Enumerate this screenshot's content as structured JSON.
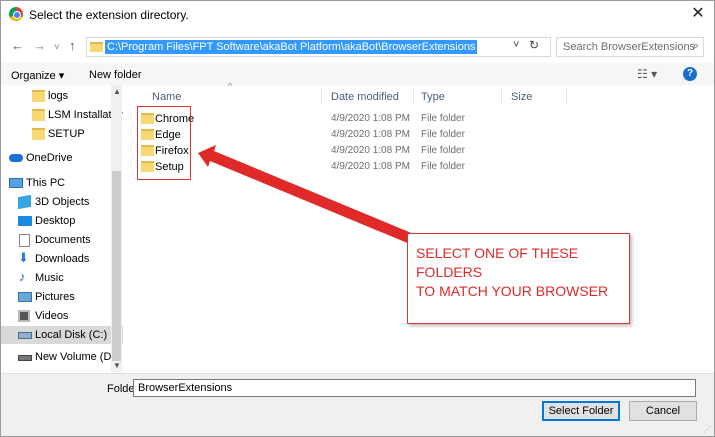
{
  "window": {
    "title": "Select the extension directory.",
    "close_glyph": "✕"
  },
  "address_bar": {
    "path": "C:\\Program Files\\FPT Software\\akaBot Platform\\akaBot\\BrowserExtensions",
    "search_placeholder": "Search BrowserExtensions",
    "nav": {
      "back": "←",
      "forward": "→",
      "recent": "˅",
      "up": "↑",
      "dropdown": "˅",
      "refresh": "↻"
    }
  },
  "toolbar": {
    "organize": "Organize ▾",
    "new_folder": "New folder",
    "view": "☷ ▾",
    "help": "?"
  },
  "nav_pane": {
    "items": [
      {
        "label": "logs",
        "icon": "folder-icon"
      },
      {
        "label": "LSM Installation",
        "icon": "folder-icon"
      },
      {
        "label": "SETUP",
        "icon": "folder-icon"
      },
      {
        "label": "OneDrive",
        "icon": "cloud-icon"
      },
      {
        "label": "This PC",
        "icon": "computer-icon"
      },
      {
        "label": "3D Objects",
        "icon": "3d-objects-icon"
      },
      {
        "label": "Desktop",
        "icon": "desktop-icon"
      },
      {
        "label": "Documents",
        "icon": "documents-icon"
      },
      {
        "label": "Downloads",
        "icon": "download-icon"
      },
      {
        "label": "Music",
        "icon": "music-icon"
      },
      {
        "label": "Pictures",
        "icon": "pictures-icon"
      },
      {
        "label": "Videos",
        "icon": "videos-icon"
      },
      {
        "label": "Local Disk (C:)",
        "icon": "local-disk-icon",
        "selected": true
      },
      {
        "label": "New Volume (D:",
        "icon": "drive-icon"
      }
    ]
  },
  "file_list": {
    "columns": [
      "Name",
      "Date modified",
      "Type",
      "Size"
    ],
    "rows": [
      {
        "name": "Chrome",
        "date": "4/9/2020 1:08 PM",
        "type": "File folder"
      },
      {
        "name": "Edge",
        "date": "4/9/2020 1:08 PM",
        "type": "File folder"
      },
      {
        "name": "Firefox",
        "date": "4/9/2020 1:08 PM",
        "type": "File folder"
      },
      {
        "name": "Setup",
        "date": "4/9/2020 1:08 PM",
        "type": "File folder"
      }
    ]
  },
  "annotation": {
    "callout_text": "SELECT ONE OF THESE FOLDERS\nTO MATCH YOUR BROWSER",
    "color": "#e02a2a"
  },
  "footer": {
    "folder_label": "Folder:",
    "folder_value": "BrowserExtensions",
    "select_button": "Select Folder",
    "cancel_button": "Cancel"
  },
  "colors": {
    "selection": "#3399ff",
    "folder": "#f8d775",
    "accent": "#0078d7"
  }
}
